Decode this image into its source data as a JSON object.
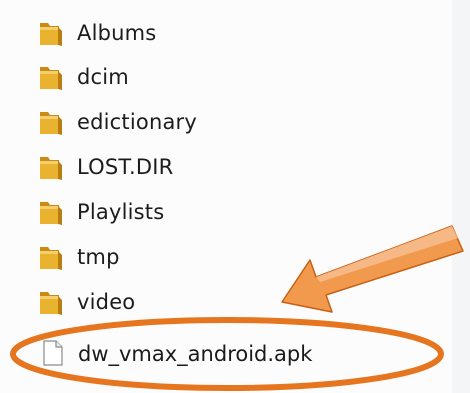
{
  "folders": [
    {
      "name": "Albums",
      "icon": "folder-icon"
    },
    {
      "name": "dcim",
      "icon": "folder-icon"
    },
    {
      "name": "edictionary",
      "icon": "folder-icon"
    },
    {
      "name": "LOST.DIR",
      "icon": "folder-icon"
    },
    {
      "name": "Playlists",
      "icon": "folder-icon"
    },
    {
      "name": "tmp",
      "icon": "folder-icon"
    },
    {
      "name": "video",
      "icon": "folder-icon"
    }
  ],
  "file": {
    "name": "dw_vmax_android.apk",
    "icon": "file-icon"
  },
  "colors": {
    "folder_body": "#e9b330",
    "folder_back": "#c98b16",
    "folder_tab": "#f2cf6a",
    "annotation_orange": "#e5761f",
    "arrow_fill": "#f19a4e",
    "text": "#1c1c1c"
  }
}
